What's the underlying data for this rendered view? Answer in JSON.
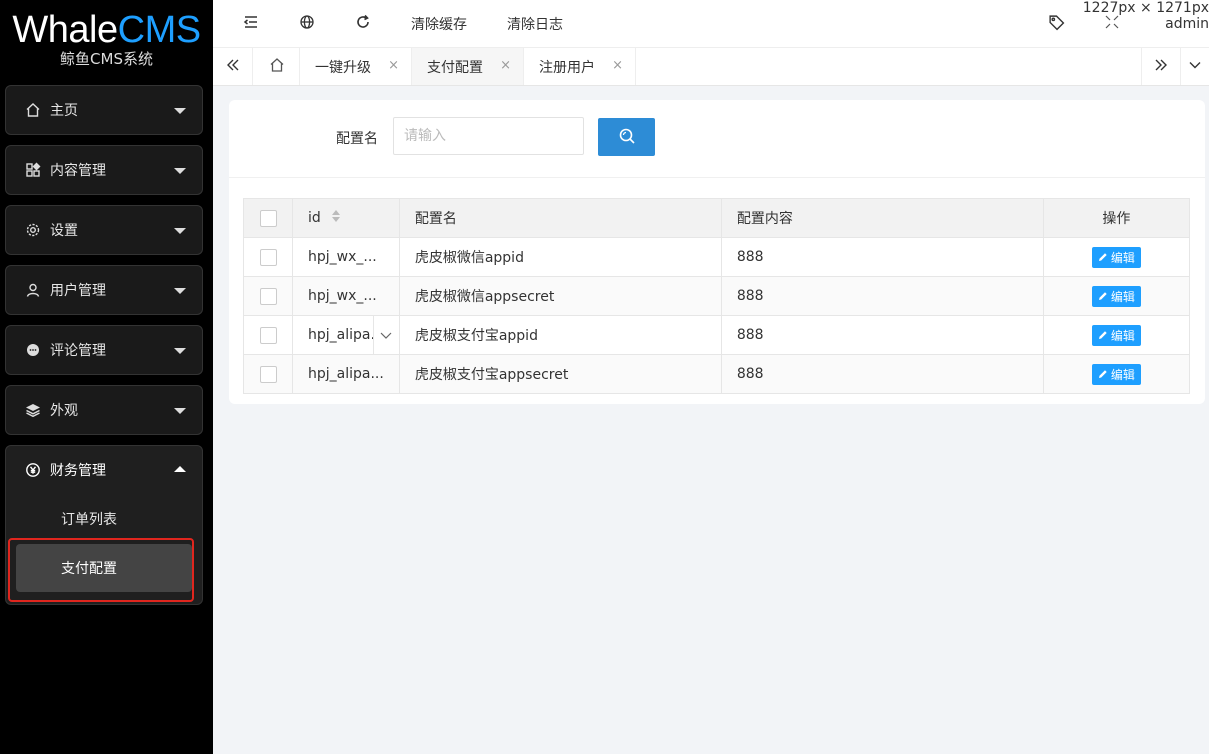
{
  "brand": {
    "part1": "Whale",
    "part2": "CMS",
    "subtitle": "鲸鱼CMS系统"
  },
  "sidebar": {
    "items": [
      {
        "label": "主页",
        "icon": "home-icon"
      },
      {
        "label": "内容管理",
        "icon": "apps-icon"
      },
      {
        "label": "设置",
        "icon": "gear-icon"
      },
      {
        "label": "用户管理",
        "icon": "user-icon"
      },
      {
        "label": "评论管理",
        "icon": "chat-icon"
      },
      {
        "label": "外观",
        "icon": "layers-icon"
      }
    ],
    "finance": {
      "label": "财务管理",
      "icon": "yen-icon",
      "children": [
        {
          "label": "订单列表"
        },
        {
          "label": "支付配置"
        }
      ]
    }
  },
  "header": {
    "clear_cache": "清除缓存",
    "clear_log": "清除日志",
    "size_readout": "1227px × 1271px",
    "user": "admin"
  },
  "tabs": [
    {
      "label": "一键升级"
    },
    {
      "label": "支付配置"
    },
    {
      "label": "注册用户"
    }
  ],
  "search": {
    "label": "配置名",
    "placeholder": "请输入"
  },
  "table": {
    "headers": {
      "id": "id",
      "name": "配置名",
      "content": "配置内容",
      "op": "操作"
    },
    "rows": [
      {
        "id": "hpj_wx_...",
        "name": "虎皮椒微信appid",
        "content": "888"
      },
      {
        "id": "hpj_wx_...",
        "name": "虎皮椒微信appsecret",
        "content": "888"
      },
      {
        "id": "hpj_alipa.",
        "name": "虎皮椒支付宝appid",
        "content": "888"
      },
      {
        "id": "hpj_alipa...",
        "name": "虎皮椒支付宝appsecret",
        "content": "888"
      }
    ],
    "edit_label": "编辑"
  },
  "colors": {
    "accent": "#1e9fff",
    "search_button": "#2d8cd6",
    "highlight": "#e0261e",
    "sidebar_bg": "#000000"
  }
}
